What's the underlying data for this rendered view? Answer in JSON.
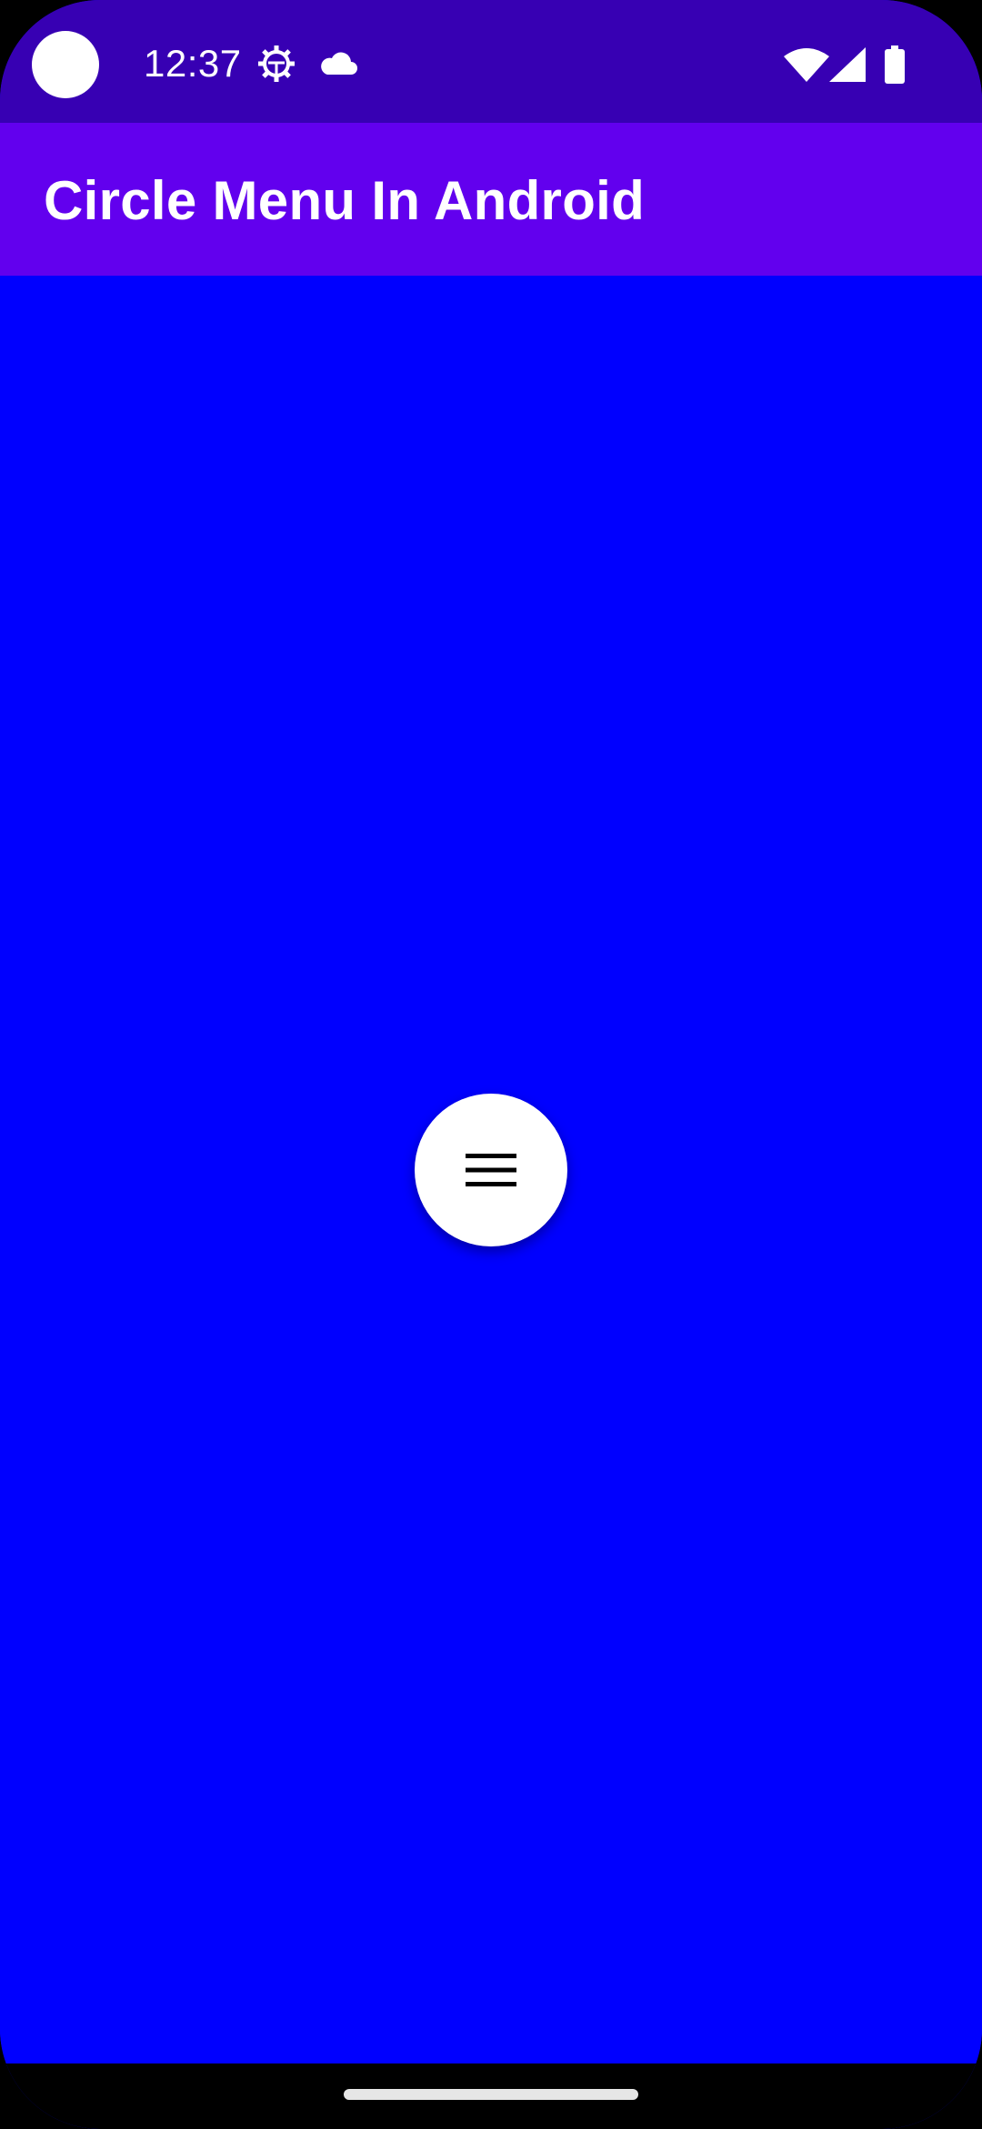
{
  "status_bar": {
    "time": "12:37",
    "icons": [
      "settings-gear-icon",
      "cloud-icon",
      "wifi-icon",
      "cellular-signal-icon",
      "battery-icon"
    ]
  },
  "app_bar": {
    "title": "Circle Menu In Android"
  },
  "content": {
    "menu_button_icon": "hamburger-menu-icon"
  },
  "colors": {
    "status_bar": "#3700B3",
    "app_bar": "#6200EE",
    "background": "#0000FF",
    "menu_button": "#FFFFFF",
    "nav_bar": "#000000"
  }
}
